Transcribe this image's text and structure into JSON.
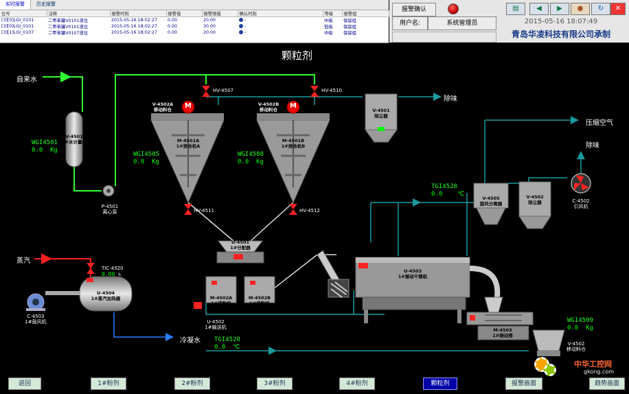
{
  "alarm_tabs": [
    "实时报警",
    "历史报警"
  ],
  "alarm_columns": [
    "位号",
    "注释",
    "报警时刻",
    "报警值",
    "报警限值",
    "确认时刻",
    "等级",
    "报警组"
  ],
  "alarm_rows": [
    [
      "[3][0]LGI_0101",
      "二甲苯罐V0101液位",
      "2015-05-16 18:02:27",
      "0.00",
      "20.00",
      "-",
      "中级",
      "保留组"
    ],
    [
      "[3][0]LGI_0101",
      "二甲苯罐V0101液位",
      "2015-05-16 18:02:27",
      "0.00",
      "30.00",
      "-",
      "低级",
      "保留组"
    ],
    [
      "[3][1]LGI_0107",
      "二甲苯罐V0107液位",
      "2015-05-16 18:02:27",
      "0.00",
      "20.00",
      "-",
      "中级",
      "保留组"
    ]
  ],
  "header": {
    "alarm_confirm": "报警确认",
    "username_label": "用户名:",
    "username": "系统管理员",
    "datetime": "2015-05-16 18:07:49",
    "company": "青岛华凌科技有限公司承制"
  },
  "title": "颗粒剂",
  "labels": {
    "tap_water": "自来水",
    "steam": "蒸汽",
    "cooling_water": "冷凝水",
    "odor1": "除味",
    "odor2": "除味",
    "compressed_air": "压缩空气"
  },
  "devices": {
    "v4501": {
      "tag": "V-4501",
      "name": "1#水计量槽"
    },
    "p4501": {
      "tag": "P-4501",
      "name": "离心泵"
    },
    "v4502a": {
      "tag": "V-4502A",
      "name": "移动料仓"
    },
    "v4502b": {
      "tag": "V-4502B",
      "name": "移动料仓"
    },
    "m4501a": {
      "tag": "M-4501A",
      "name": "1#捏合机A"
    },
    "m4501b": {
      "tag": "M-4501B",
      "name": "1#捏合机B"
    },
    "v4501dust": {
      "tag": "V-4501",
      "name": "除尘器"
    },
    "u4501": {
      "tag": "U-4501",
      "name": "1#分配器"
    },
    "m4502a": {
      "tag": "M-4502A",
      "name": "1#造粒机"
    },
    "m4502b": {
      "tag": "M-4502B",
      "name": "1#造粒机"
    },
    "u4502": {
      "tag": "U-4502",
      "name": "1#输送机"
    },
    "u4503": {
      "tag": "U-4503",
      "name": "1#振动干燥机"
    },
    "v4505": {
      "tag": "V-4505",
      "name": "旋风分离器"
    },
    "v4502dust": {
      "tag": "V-4502",
      "name": "除尘器"
    },
    "c4502": {
      "tag": "C-4502",
      "name": "引风机"
    },
    "u4504": {
      "tag": "U-4504",
      "name": "1#蒸汽加热器"
    },
    "c4503": {
      "tag": "C-4503",
      "name": "1#鼓风机"
    },
    "m4503": {
      "tag": "M-4503",
      "name": "1#振动筛"
    },
    "v4502bin": {
      "tag": "V-4502",
      "name": "移动料仓"
    }
  },
  "valves": {
    "hv4507": "HV-4507",
    "hv4510": "HV-4510",
    "hv4511": "HV-4511",
    "hv4512": "HV-4512"
  },
  "motor_letter": "M",
  "instruments": {
    "wgi4501": {
      "tag": "WGI4501",
      "value": "0.0",
      "unit": "Kg"
    },
    "wgi4505": {
      "tag": "WGI4505",
      "value": "0.0",
      "unit": "Kg"
    },
    "wgi4508": {
      "tag": "WGI4508",
      "value": "0.0",
      "unit": "Kg"
    },
    "tgi4528": {
      "tag": "TGI4528",
      "value": "0.0",
      "unit": "℃"
    },
    "tic4520": {
      "tag": "TIC-4520",
      "value": "0.00",
      "unit": "%"
    },
    "tgi4520": {
      "tag": "TGI4520",
      "value": "0.0",
      "unit": "℃"
    },
    "wgi4509": {
      "tag": "WGI4509",
      "value": "0.0",
      "unit": "Kg"
    }
  },
  "nav": [
    "返回",
    "1#粉剂",
    "2#粉剂",
    "3#粉剂",
    "4#粉剂",
    "颗粒剂",
    "报警画面",
    "趋势画面"
  ],
  "nav_active": 5,
  "watermark": {
    "site": "中华工控网",
    "url": "gkong.com"
  }
}
